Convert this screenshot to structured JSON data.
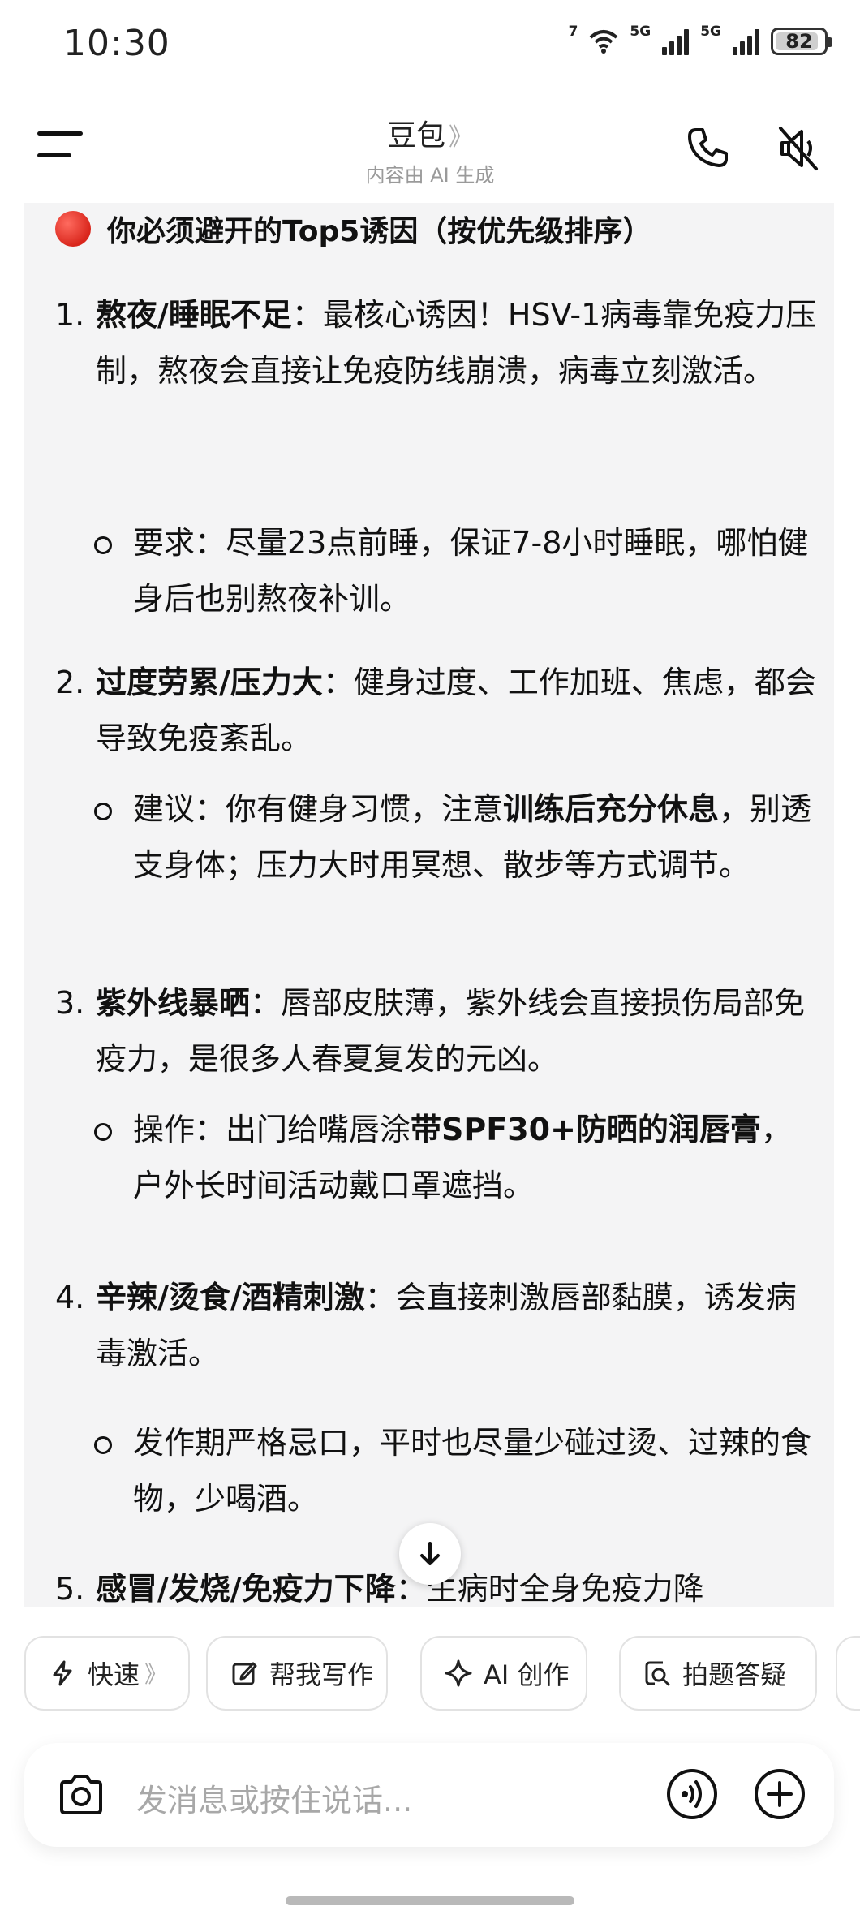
{
  "status_bar": {
    "time": "10:30",
    "wifi_label": "7",
    "signal1_label": "5G",
    "signal2_label": "5G",
    "battery_level": "82"
  },
  "header": {
    "title": "豆包",
    "title_chevron": "》",
    "subtitle": "内容由 AI 生成",
    "icons": [
      "menu-icon",
      "phone-icon",
      "mute-icon"
    ]
  },
  "message": {
    "heading": "你必须避开的Top5诱因（按优先级排序）",
    "items": [
      {
        "num": "1.",
        "bold": "熬夜/睡眠不足",
        "text": "：最核心诱因！HSV-1病毒靠免疫力压制，熬夜会直接让免疫防线崩溃，病毒立刻激活。",
        "sub": {
          "pre": "要求：尽量23点前睡，保证7-8小时睡眠，哪怕健身后也别熬夜补训。",
          "bold": "",
          "post": ""
        }
      },
      {
        "num": "2.",
        "bold": "过度劳累/压力大",
        "text": "：健身过度、工作加班、焦虑，都会导致免疫紊乱。",
        "sub": {
          "pre": "建议：你有健身习惯，注意",
          "bold": "训练后充分休息",
          "post": "，别透支身体；压力大时用冥想、散步等方式调节。"
        }
      },
      {
        "num": "3.",
        "bold": "紫外线暴晒",
        "text": "：唇部皮肤薄，紫外线会直接损伤局部免疫力，是很多人春夏复发的元凶。",
        "sub": {
          "pre": "操作：出门给嘴唇涂",
          "bold": "带SPF30+防晒的润唇膏",
          "post": "，户外长时间活动戴口罩遮挡。"
        }
      },
      {
        "num": "4.",
        "bold": "辛辣/烫食/酒精刺激",
        "text": "：会直接刺激唇部黏膜，诱发病毒激活。",
        "sub": {
          "pre": "发作期严格忌口，平时也尽量少碰过烫、过辣的食物，少喝酒。",
          "bold": "",
          "post": ""
        }
      },
      {
        "num": "5.",
        "bold": "感冒/发烧/免疫力下降",
        "text": "：生病时全身免疫力降"
      }
    ]
  },
  "quick_actions": [
    {
      "label": "快速",
      "icon": "lightning-icon",
      "chevron": "》"
    },
    {
      "label": "帮我写作",
      "icon": "edit-icon"
    },
    {
      "label": "AI 创作",
      "icon": "sparkle-icon"
    },
    {
      "label": "拍题答疑",
      "icon": "photo-search-icon"
    }
  ],
  "input": {
    "placeholder": "发消息或按住说话..."
  },
  "colors": {
    "background": "#ffffff",
    "message_bg": "#f4f4f5",
    "text": "#111111",
    "muted": "#9a9a9a",
    "placeholder": "#a8a8a8",
    "reddot": "#d9261c"
  }
}
